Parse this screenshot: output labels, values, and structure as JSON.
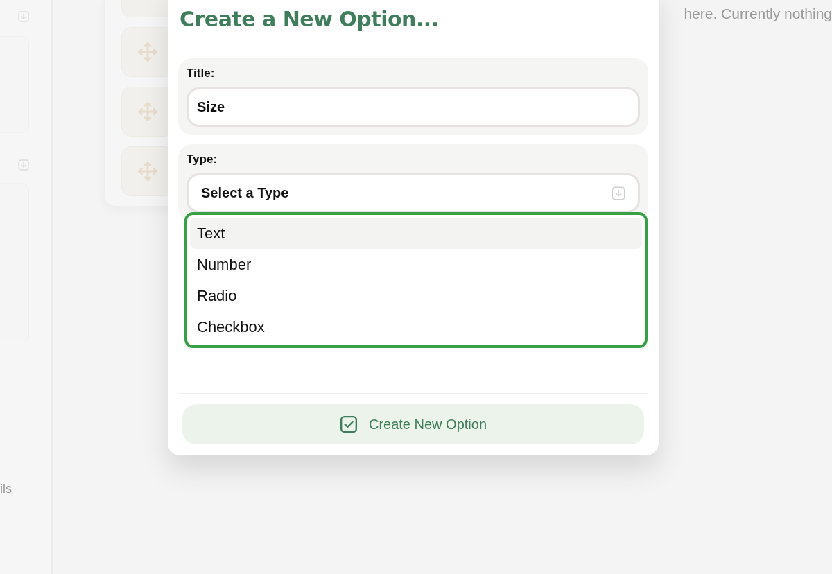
{
  "background": {
    "hint_text": "here. Currently nothing",
    "sidebar_text": "ils"
  },
  "modal": {
    "title": "Create a New Option...",
    "fields": [
      {
        "kind": "text",
        "label": "Title:",
        "value": "Size"
      },
      {
        "kind": "select",
        "label": "Type:",
        "value": "Select a Type",
        "expanded": true,
        "options": [
          {
            "label": "Text",
            "selected": true
          },
          {
            "label": "Number",
            "selected": false
          },
          {
            "label": "Radio",
            "selected": false
          },
          {
            "label": "Checkbox",
            "selected": false
          }
        ]
      }
    ],
    "submit_button": "Create New Option"
  }
}
